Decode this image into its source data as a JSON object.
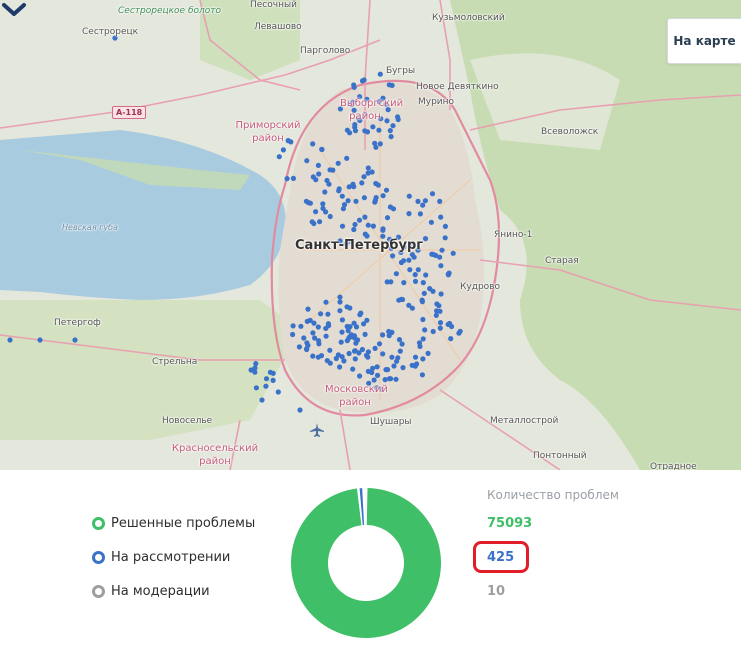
{
  "map": {
    "button_label": "На карте",
    "route_shield": "А-118",
    "place_labels": {
      "sestroretsk": "Сестрорецк",
      "sestroretsk_boloto": "Сестрорецкое болото",
      "pesochny": "Песочный",
      "levashovo": "Левашово",
      "pargolovo": "Парголово",
      "kuzmolovsky": "Кузьмоловский",
      "bugry": "Бугры",
      "novoe_devyatkino": "Новое Девяткино",
      "murino": "Мурино",
      "vyborgsky_rayon": "Выборгский район",
      "primorsky_rayon": "Приморский район",
      "vsevolozhsk": "Всеволожск",
      "nevskaya_guba": "Невская губа",
      "saint_petersburg": "Санкт-Петербург",
      "yanino": "Янино-1",
      "staraya": "Старая",
      "kudrovo": "Кудрово",
      "petergof": "Петергоф",
      "strelna": "Стрельна",
      "moskovsky_rayon": "Московский район",
      "novoselye": "Новоселье",
      "shushary": "Шушары",
      "metallostroy": "Металлострой",
      "krasnoselsky_rayon": "Красносельский район",
      "pontonny": "Понтонный",
      "otradnoe": "Отрадное"
    },
    "colors": {
      "water": "#a9cbe0",
      "land": "#e4e7dc",
      "forest": "#c7dcb2",
      "urban": "#e3dcd3",
      "road": "#e8a0b0",
      "marker": "#3b72c9"
    },
    "icons": {
      "collapse": "chevron-down-icon",
      "airport": "airplane-icon"
    }
  },
  "stats": {
    "count_heading": "Количество проблем",
    "categories": [
      {
        "label": "Решенные проблемы",
        "count": "75093",
        "color": "#3fbf67"
      },
      {
        "label": "На рассмотрении",
        "count": "425",
        "color": "#3b72c9"
      },
      {
        "label": "На модерации",
        "count": "10",
        "color": "#9e9e9e"
      }
    ],
    "highlight_color": "#e11d2a"
  },
  "chart_data": {
    "type": "pie",
    "categories": [
      "Решенные проблемы",
      "На рассмотрении",
      "На модерации"
    ],
    "values": [
      75093,
      425,
      10
    ],
    "colors": [
      "#3fbf67",
      "#3b72c9",
      "#9e9e9e"
    ]
  }
}
